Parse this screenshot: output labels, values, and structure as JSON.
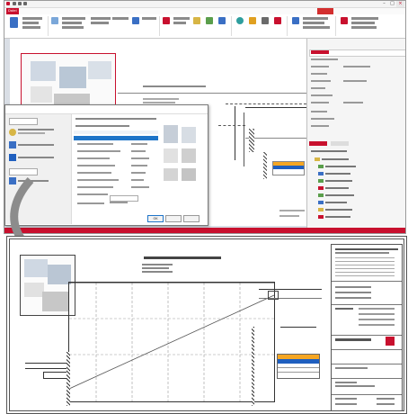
{
  "app": {
    "title": "",
    "tabs": [
      "Datei",
      "",
      "",
      "",
      "",
      "",
      "",
      "",
      ""
    ],
    "active_tab_index": 8,
    "brand_color": "#c8102e"
  },
  "dialog": {
    "title": "",
    "left_items": [
      "",
      "",
      "",
      ""
    ],
    "rows": [
      {
        "label": "",
        "value": "",
        "unit": ""
      },
      {
        "label": "",
        "value": "",
        "unit": ""
      }
    ],
    "buttons": [
      "OK",
      "",
      ""
    ]
  },
  "logo_text": "",
  "bottom_drawing": {
    "title": "",
    "subtitle": ""
  },
  "icons": {
    "undo": "undo-icon",
    "redo": "redo-icon",
    "save": "save-icon",
    "close": "close-icon",
    "minimize": "minimize-icon",
    "maximize": "maximize-icon",
    "arrow": "curved-arrow-icon"
  },
  "colors": {
    "accent_red": "#c8102e",
    "selection_blue": "#1e74c8",
    "legend_orange": "#f5a623",
    "legend_blue": "#1f5fbf",
    "arrow_gray": "#8c8c8c"
  }
}
